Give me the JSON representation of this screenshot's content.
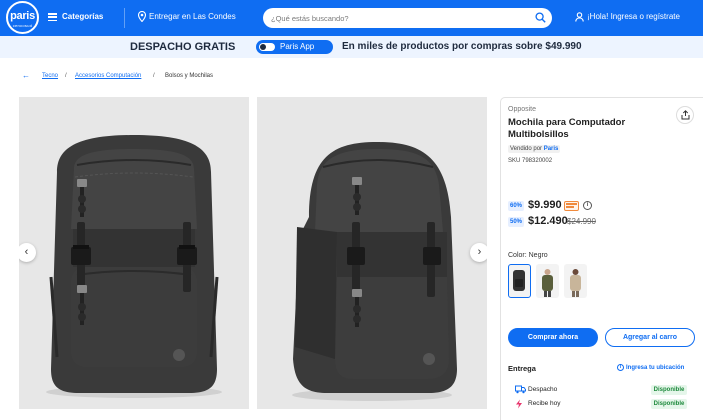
{
  "colors": {
    "primary": "#0f6df2",
    "available_bg": "#e5f6ea",
    "available_fg": "#1e8a3c",
    "accent_orange": "#f08a3c"
  },
  "header": {
    "logo_text": "paris",
    "logo_subtext": "cencosud",
    "categories_label": "Categorías",
    "location_label": "Entregar en Las Condes",
    "search_placeholder": "¿Qué estás buscando?",
    "login_label": "¡Hola! Ingresa o regístrate"
  },
  "promo": {
    "title": "DESPACHO GRATIS",
    "app_label": "Paris App",
    "text": "En miles de productos por compras sobre $49.990"
  },
  "breadcrumb": {
    "items": [
      "Tecno",
      "Accesorios Computación"
    ],
    "current": "Bolsos y Mochilas"
  },
  "product": {
    "brand": "Opposite",
    "title": "Mochila para Computador Multibolsillos",
    "seller_prefix": "Vendido por",
    "seller_name": "Paris",
    "sku": "SKU 798320002",
    "price_card": {
      "discount": "60%",
      "price": "$9.990"
    },
    "price_regular": {
      "discount": "50%",
      "price": "$12.490",
      "original": "$24.990"
    },
    "color_label": "Color: Negro",
    "buy_label": "Comprar ahora",
    "cart_label": "Agregar al carro"
  },
  "delivery": {
    "title": "Entrega",
    "location_link": "Ingresa tu ubicación",
    "options": [
      {
        "label": "Despacho",
        "status": "Disponible"
      },
      {
        "label": "Recibe hoy",
        "status": "Disponible"
      }
    ]
  }
}
